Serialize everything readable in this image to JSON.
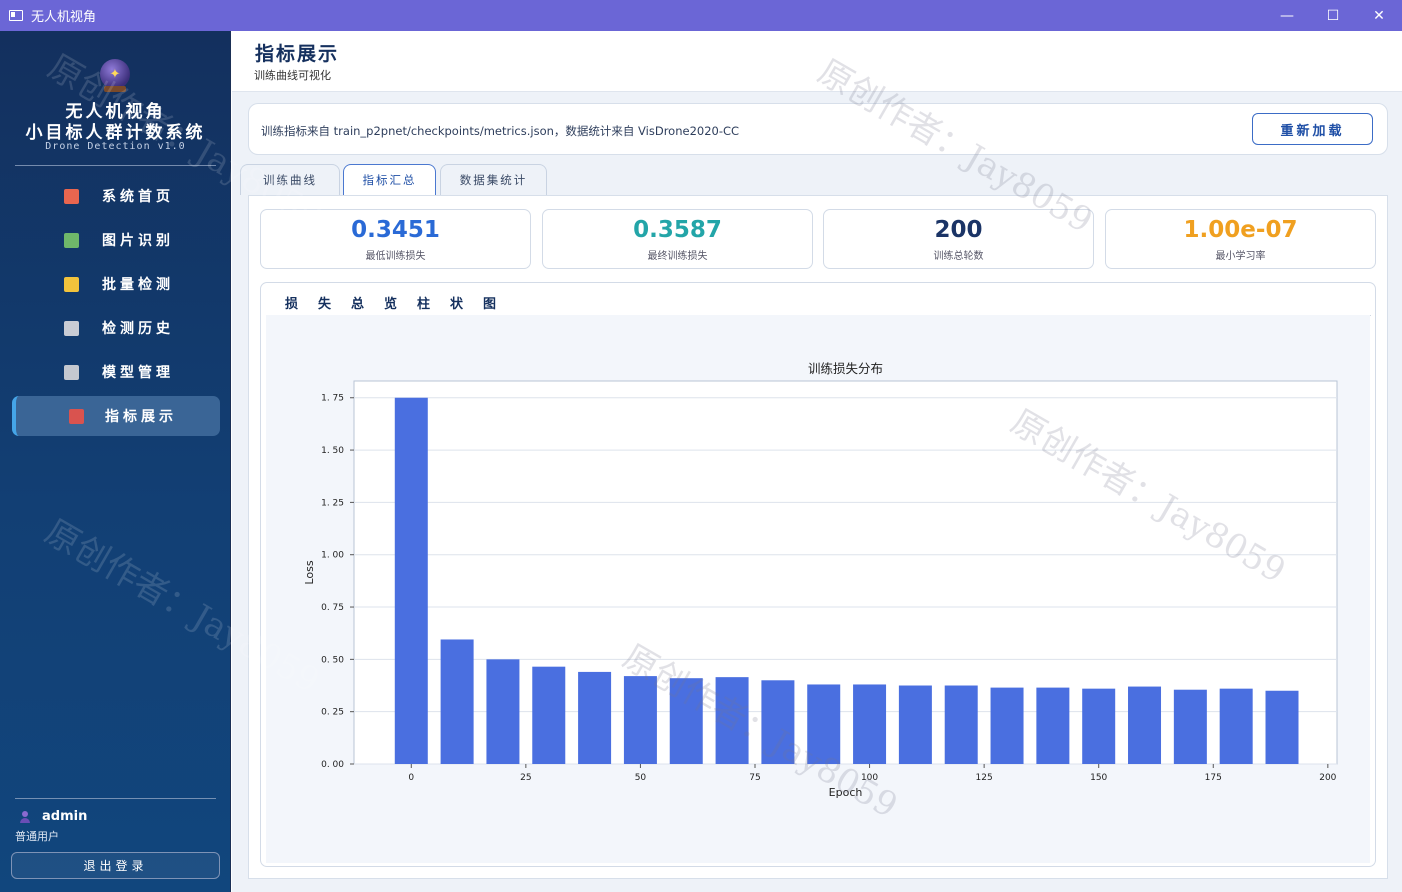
{
  "window": {
    "title": "无人机视角",
    "controls": [
      "—",
      "☐",
      "✕"
    ]
  },
  "sidebar": {
    "brand_line1": "无人机视角",
    "brand_line2": "小目标人群计数系统",
    "brand_version": "Drone Detection v1.0",
    "items": [
      {
        "label": "系统首页",
        "icon": "home-icon",
        "color": "#e9664f"
      },
      {
        "label": "图片识别",
        "icon": "image-icon",
        "color": "#6fb86a"
      },
      {
        "label": "批量检测",
        "icon": "folder-icon",
        "color": "#f2c33c"
      },
      {
        "label": "检测历史",
        "icon": "history-icon",
        "color": "#c9ccd4"
      },
      {
        "label": "模型管理",
        "icon": "gear-icon",
        "color": "#c4c8d0"
      },
      {
        "label": "指标展示",
        "icon": "bar-chart-icon",
        "color": "#d9534f"
      }
    ],
    "active_index": 5,
    "user": {
      "name": "admin",
      "role": "普通用户"
    },
    "logout_label": "退出登录"
  },
  "header": {
    "title": "指标展示",
    "subtitle": "训练曲线可视化"
  },
  "info": {
    "text": "训练指标来自 train_p2pnet/checkpoints/metrics.json，数据统计来自 VisDrone2020-CC",
    "reload_label": "重新加载"
  },
  "tabs": [
    {
      "label": "训练曲线"
    },
    {
      "label": "指标汇总"
    },
    {
      "label": "数据集统计"
    }
  ],
  "active_tab": 1,
  "stats": [
    {
      "value": "0.3451",
      "label": "最低训练损失",
      "color": "#2a6ad6"
    },
    {
      "value": "0.3587",
      "label": "最终训练损失",
      "color": "#23a5a8"
    },
    {
      "value": "200",
      "label": "训练总轮数",
      "color": "#1b3466"
    },
    {
      "value": "1.00e-07",
      "label": "最小学习率",
      "color": "#f0a020"
    }
  ],
  "summary_card_title": "损失总览柱状图",
  "watermark": "原创作者：Jay8059",
  "chart_data": {
    "type": "bar",
    "title": "训练损失分布",
    "xlabel": "Epoch",
    "ylabel": "Loss",
    "x": [
      0,
      10,
      20,
      30,
      40,
      50,
      60,
      70,
      80,
      90,
      100,
      110,
      120,
      130,
      140,
      150,
      160,
      170,
      180,
      190
    ],
    "values": [
      1.75,
      0.595,
      0.5,
      0.465,
      0.44,
      0.42,
      0.41,
      0.415,
      0.4,
      0.38,
      0.38,
      0.375,
      0.375,
      0.365,
      0.365,
      0.36,
      0.37,
      0.355,
      0.36,
      0.35
    ],
    "bar_color": "#4a6fe0",
    "xlim": [
      -12.5,
      202
    ],
    "ylim": [
      0,
      1.83
    ],
    "xticks": [
      0,
      25,
      50,
      75,
      100,
      125,
      150,
      175,
      200
    ],
    "yticks": [
      0.0,
      0.25,
      0.5,
      0.75,
      1.0,
      1.25,
      1.5,
      1.75
    ],
    "xtick_labels": [
      "0",
      "25",
      "50",
      "75",
      "100",
      "125",
      "150",
      "175",
      "200"
    ],
    "ytick_labels": [
      "0. 00",
      "0. 25",
      "0. 50",
      "0. 75",
      "1. 00",
      "1. 25",
      "1. 50",
      "1. 75"
    ],
    "grid": "y"
  }
}
